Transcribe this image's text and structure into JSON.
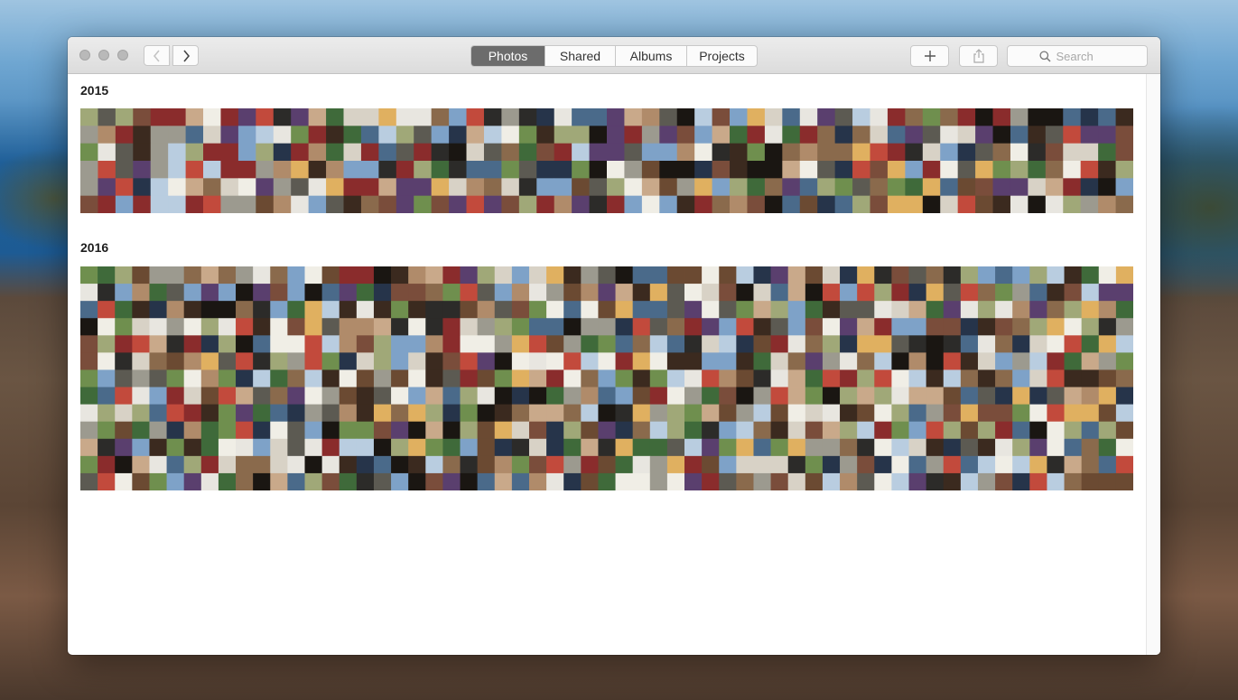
{
  "window": {
    "tabs": [
      {
        "label": "Photos",
        "active": true
      },
      {
        "label": "Shared",
        "active": false
      },
      {
        "label": "Albums",
        "active": false
      },
      {
        "label": "Projects",
        "active": false
      }
    ],
    "search_placeholder": "Search"
  },
  "icons": {
    "back": "chevron-left-icon",
    "forward": "chevron-right-icon",
    "add": "plus-icon",
    "share": "share-icon",
    "search": "magnifier-icon"
  },
  "sections": [
    {
      "year": "2015",
      "rows": 6
    },
    {
      "year": "2016",
      "rows": 13
    }
  ],
  "colors": {
    "active_tab": "#6c6c6c",
    "window_bg": "#ffffff",
    "titlebar": "#dcdcdc",
    "thumb_palette": [
      "#3b2a1f",
      "#6b4a32",
      "#8a6a4c",
      "#b08b6a",
      "#c9a98a",
      "#d8d2c6",
      "#9c9a8f",
      "#5c5a52",
      "#2c2b29",
      "#1a1612",
      "#4a6a8a",
      "#7ea2c8",
      "#b9cde0",
      "#3f6a3a",
      "#6f8f4e",
      "#a0a878",
      "#8a2c2c",
      "#c24a3c",
      "#e0b060",
      "#5a3f6e",
      "#e8e6e0",
      "#f0eee6",
      "#26344a",
      "#7a4d3b"
    ]
  }
}
